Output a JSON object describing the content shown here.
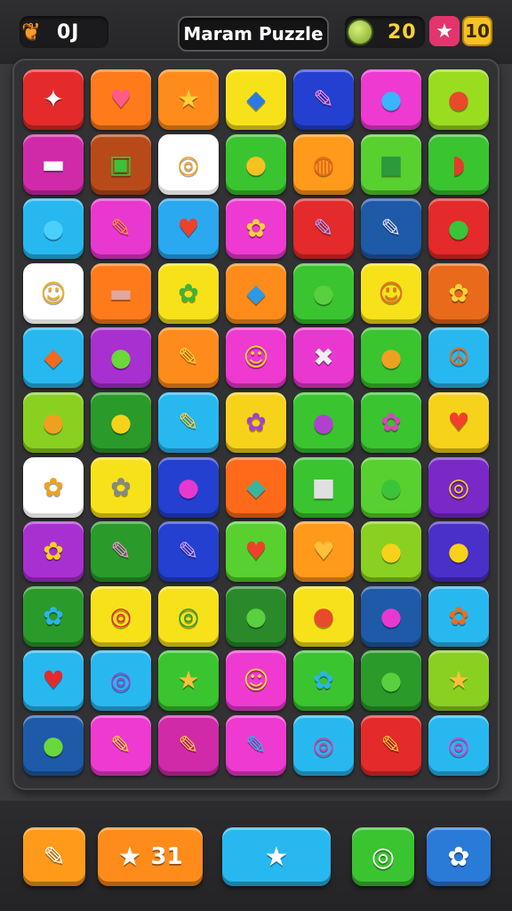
{
  "header": {
    "score_icon": "paw-icon",
    "score_value": "0J",
    "title": "Maram Puzzle",
    "coin_icon": "leaf-coin-icon",
    "coins_value": "20",
    "star_badge_icon": "star-icon",
    "level_value": "10"
  },
  "board": {
    "rows": 11,
    "cols": 7,
    "tiles": [
      [
        {
          "c": "#e42a2a",
          "i": "✦",
          "g": "#ffffff",
          "n": "rocket"
        },
        {
          "c": "#ff7a1a",
          "i": "♥",
          "g": "#ff5a8a",
          "n": "heart"
        },
        {
          "c": "#ff8c1a",
          "i": "★",
          "g": "#ffd23a",
          "n": "star"
        },
        {
          "c": "#f7e21a",
          "i": "◆",
          "g": "#2a7ae4",
          "n": "cube"
        },
        {
          "c": "#2440d0",
          "i": "✎",
          "g": "#ff8ae4",
          "n": "brush"
        },
        {
          "c": "#ee3ad0",
          "i": "●",
          "g": "#3ab4ff",
          "n": "ball"
        },
        {
          "c": "#9adc20",
          "i": "●",
          "g": "#e84a2a",
          "n": "fruit"
        }
      ],
      [
        {
          "c": "#d02aa8",
          "i": "▬",
          "g": "#ffffff",
          "n": "card"
        },
        {
          "c": "#b84a1a",
          "i": "▣",
          "g": "#3ac43a",
          "n": "box"
        },
        {
          "c": "#ffffff",
          "i": "◎",
          "g": "#f0a020",
          "n": "target"
        },
        {
          "c": "#3ac430",
          "i": "●",
          "g": "#f7c221",
          "n": "ball"
        },
        {
          "c": "#ff9a1a",
          "i": "◍",
          "g": "#e86a20",
          "n": "shell"
        },
        {
          "c": "#58d030",
          "i": "■",
          "g": "#2a9a3a",
          "n": "cube"
        },
        {
          "c": "#3ac430",
          "i": "◗",
          "g": "#e83a2a",
          "n": "bowl"
        }
      ],
      [
        {
          "c": "#28b8f0",
          "i": "●",
          "g": "#4ad0ff",
          "n": "bubble"
        },
        {
          "c": "#e838d0",
          "i": "✎",
          "g": "#ff8a3a",
          "n": "carrot"
        },
        {
          "c": "#2aa8f0",
          "i": "♥",
          "g": "#f0402a",
          "n": "heart"
        },
        {
          "c": "#ee3ad0",
          "i": "✿",
          "g": "#ffd23a",
          "n": "flower"
        },
        {
          "c": "#e42a2a",
          "i": "✎",
          "g": "#b4a0ff",
          "n": "feather"
        },
        {
          "c": "#1e5aa8",
          "i": "✎",
          "g": "#e0e0ff",
          "n": "wand"
        },
        {
          "c": "#e42a2a",
          "i": "●",
          "g": "#3ac43a",
          "n": "leaf"
        }
      ],
      [
        {
          "c": "#ffffff",
          "i": "☺",
          "g": "#f0b020",
          "n": "smile"
        },
        {
          "c": "#ff7a1a",
          "i": "▬",
          "g": "#e0a8a0",
          "n": "tile"
        },
        {
          "c": "#f7e21a",
          "i": "✿",
          "g": "#3ab43a",
          "n": "plant"
        },
        {
          "c": "#ff8c1a",
          "i": "◆",
          "g": "#2a9ae4",
          "n": "cube"
        },
        {
          "c": "#3ac430",
          "i": "●",
          "g": "#5ad040",
          "n": "ball"
        },
        {
          "c": "#f7e21a",
          "i": "☺",
          "g": "#f06a20",
          "n": "face"
        },
        {
          "c": "#e86a1a",
          "i": "✿",
          "g": "#ffd23a",
          "n": "gem"
        }
      ],
      [
        {
          "c": "#28b8f0",
          "i": "◆",
          "g": "#f06a20",
          "n": "shield"
        },
        {
          "c": "#a830d0",
          "i": "●",
          "g": "#6ad83a",
          "n": "leaf"
        },
        {
          "c": "#ff8c1a",
          "i": "✎",
          "g": "#ffd23a",
          "n": "lolly"
        },
        {
          "c": "#ee3ad0",
          "i": "☺",
          "g": "#ffd23a",
          "n": "smile"
        },
        {
          "c": "#e838d0",
          "i": "✖",
          "g": "#f0f0f0",
          "n": "ribbon"
        },
        {
          "c": "#3ac430",
          "i": "●",
          "g": "#f0a020",
          "n": "fruit"
        },
        {
          "c": "#28b8f0",
          "i": "☮",
          "g": "#e86a20",
          "n": "peace"
        }
      ],
      [
        {
          "c": "#8ad020",
          "i": "●",
          "g": "#f0a020",
          "n": "shell"
        },
        {
          "c": "#2a9a2a",
          "i": "●",
          "g": "#f7d21a",
          "n": "apple"
        },
        {
          "c": "#28b8f0",
          "i": "✎",
          "g": "#ffd23a",
          "n": "key"
        },
        {
          "c": "#f7d21a",
          "i": "✿",
          "g": "#a040d0",
          "n": "gear"
        },
        {
          "c": "#3ac430",
          "i": "●",
          "g": "#b040d0",
          "n": "berry"
        },
        {
          "c": "#3ac430",
          "i": "✿",
          "g": "#e040c0",
          "n": "monster"
        },
        {
          "c": "#f7d21a",
          "i": "♥",
          "g": "#f0402a",
          "n": "heart"
        }
      ],
      [
        {
          "c": "#ffffff",
          "i": "✿",
          "g": "#f0a020",
          "n": "cookie"
        },
        {
          "c": "#f7e21a",
          "i": "✿",
          "g": "#808890",
          "n": "gear"
        },
        {
          "c": "#2440d0",
          "i": "●",
          "g": "#e838d0",
          "n": "ball"
        },
        {
          "c": "#ff6a1a",
          "i": "◆",
          "g": "#3ab4a0",
          "n": "leaf"
        },
        {
          "c": "#3ac430",
          "i": "■",
          "g": "#e0e0e0",
          "n": "cube"
        },
        {
          "c": "#58d030",
          "i": "●",
          "g": "#3ac43a",
          "n": "ball"
        },
        {
          "c": "#7a28c8",
          "i": "◎",
          "g": "#f7d21a",
          "n": "ring"
        }
      ],
      [
        {
          "c": "#a830d0",
          "i": "✿",
          "g": "#f7d21a",
          "n": "cookie"
        },
        {
          "c": "#2a9a2a",
          "i": "✎",
          "g": "#ff8ae4",
          "n": "brush"
        },
        {
          "c": "#2440d0",
          "i": "✎",
          "g": "#d0a0ff",
          "n": "pencil"
        },
        {
          "c": "#58d030",
          "i": "♥",
          "g": "#f0402a",
          "n": "heart"
        },
        {
          "c": "#ff9a1a",
          "i": "♥",
          "g": "#ffc03a",
          "n": "heart"
        },
        {
          "c": "#8ad020",
          "i": "●",
          "g": "#f7d21a",
          "n": "leaf"
        },
        {
          "c": "#4a30c8",
          "i": "●",
          "g": "#f7d21a",
          "n": "lemon"
        }
      ],
      [
        {
          "c": "#2a9a2a",
          "i": "✿",
          "g": "#2ab4f0",
          "n": "fish"
        },
        {
          "c": "#f7e21a",
          "i": "◎",
          "g": "#e42a2a",
          "n": "target"
        },
        {
          "c": "#f7e21a",
          "i": "◎",
          "g": "#2a9a3a",
          "n": "ring"
        },
        {
          "c": "#2a8a2a",
          "i": "●",
          "g": "#5ad040",
          "n": "ball"
        },
        {
          "c": "#f7e21a",
          "i": "●",
          "g": "#e84a2a",
          "n": "fruit"
        },
        {
          "c": "#1e5aa8",
          "i": "●",
          "g": "#e838d0",
          "n": "berry"
        },
        {
          "c": "#28b8f0",
          "i": "✿",
          "g": "#f06a20",
          "n": "flower"
        }
      ],
      [
        {
          "c": "#28b8f0",
          "i": "♥",
          "g": "#e42a2a",
          "n": "heart"
        },
        {
          "c": "#28b8f0",
          "i": "◎",
          "g": "#a040d0",
          "n": "ring"
        },
        {
          "c": "#3ac430",
          "i": "★",
          "g": "#ffc03a",
          "n": "star"
        },
        {
          "c": "#ee3ad0",
          "i": "☺",
          "g": "#ffd23a",
          "n": "smile"
        },
        {
          "c": "#3ac430",
          "i": "✿",
          "g": "#2ab4f0",
          "n": "bubble"
        },
        {
          "c": "#2a9a2a",
          "i": "●",
          "g": "#5ad040",
          "n": "ball"
        },
        {
          "c": "#8ad020",
          "i": "★",
          "g": "#ffc03a",
          "n": "star"
        }
      ],
      [
        {
          "c": "#1e5aa8",
          "i": "●",
          "g": "#6ad83a",
          "n": "leaf"
        },
        {
          "c": "#ee3ad0",
          "i": "✎",
          "g": "#ffd23a",
          "n": "feather"
        },
        {
          "c": "#d02aa8",
          "i": "✎",
          "g": "#ffc03a",
          "n": "lolly"
        },
        {
          "c": "#ee3ad0",
          "i": "✎",
          "g": "#2ab4f0",
          "n": "feather"
        },
        {
          "c": "#28b8f0",
          "i": "◎",
          "g": "#e838a0",
          "n": "target"
        },
        {
          "c": "#e42a2a",
          "i": "✎",
          "g": "#ffc03a",
          "n": "torch"
        },
        {
          "c": "#28b8f0",
          "i": "◎",
          "g": "#e838d0",
          "n": "ring"
        }
      ]
    ]
  },
  "footer": {
    "buttons": [
      {
        "name": "hammer-button",
        "icon": "✎",
        "icon_name": "hammer-icon",
        "color": "#ff9a1a",
        "value": ""
      },
      {
        "name": "star-count-button",
        "icon": "★",
        "icon_name": "star-icon",
        "color": "#ff8c1a",
        "value": "31"
      },
      {
        "name": "star-boost-button",
        "icon": "★",
        "icon_name": "star-icon",
        "color": "#28b8f0",
        "value": ""
      },
      {
        "name": "bomb-button",
        "icon": "◎",
        "icon_name": "bomb-icon",
        "color": "#3ac430",
        "value": ""
      },
      {
        "name": "settings-button",
        "icon": "✿",
        "icon_name": "gear-icon",
        "color": "#2a7ad8",
        "value": ""
      }
    ]
  }
}
